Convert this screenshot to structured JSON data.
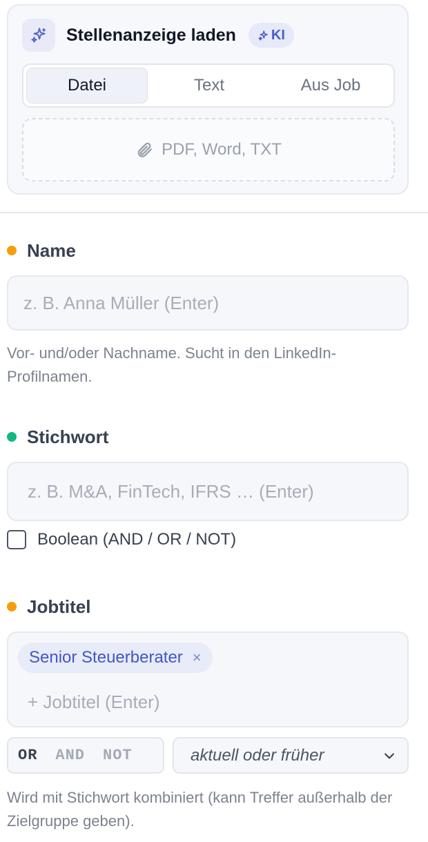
{
  "job_ad_loader": {
    "title": "Stellenanzeige laden",
    "ai_badge": "KI",
    "icon": "sparkles-icon",
    "tabs": [
      {
        "label": "Datei",
        "active": true
      },
      {
        "label": "Text",
        "active": false
      },
      {
        "label": "Aus Job",
        "active": false
      }
    ],
    "dropzone": {
      "label": "PDF, Word, TXT",
      "icon": "paperclip-icon"
    }
  },
  "name_field": {
    "label": "Name",
    "dot_color": "#f59e0b",
    "placeholder": "z. B. Anna Müller (Enter)",
    "value": "",
    "hint": "Vor- und/oder Nachname. Sucht in den LinkedIn-Profilnamen."
  },
  "keyword_field": {
    "label": "Stichwort",
    "dot_color": "#10b981",
    "placeholder": "z. B. M&A, FinTech, IFRS … (Enter)",
    "value": "",
    "boolean_label": "Boolean (AND / OR / NOT)",
    "boolean_checked": false
  },
  "jobtitle_field": {
    "label": "Jobtitel",
    "dot_color": "#f59e0b",
    "tags": [
      "Senior Steuerberater"
    ],
    "remove_symbol": "×",
    "placeholder": "+ Jobtitel (Enter)",
    "logic_options": [
      {
        "label": "OR",
        "active": true
      },
      {
        "label": "AND",
        "active": false
      },
      {
        "label": "NOT",
        "active": false
      }
    ],
    "timeframe": "aktuell oder früher",
    "hint": "Wird mit Stichwort kombiniert (kann Treffer außerhalb der Zielgruppe geben)."
  }
}
